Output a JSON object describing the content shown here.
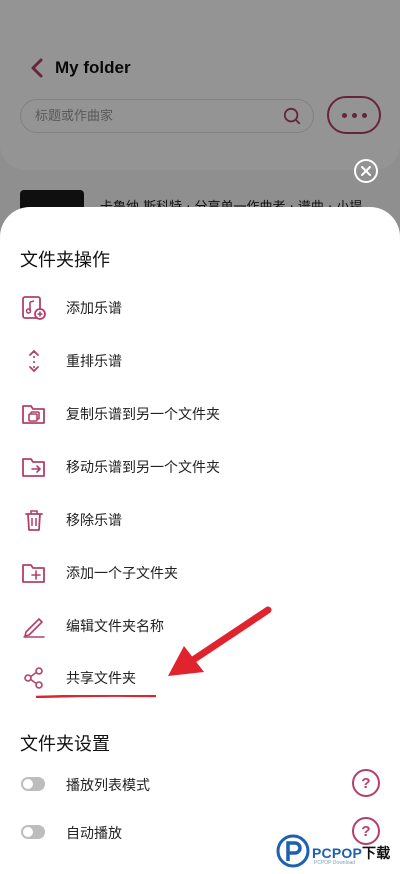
{
  "header": {
    "title": "My folder",
    "search_placeholder": "标题或作曲家",
    "bg_row_text": "卡鲁纳 斯科特  · 分享单一作曲者 · 谱曲 · 小提"
  },
  "sheet": {
    "folder_ops_title": "文件夹操作",
    "items": [
      {
        "label": "添加乐谱",
        "icon": "add-score-icon"
      },
      {
        "label": "重排乐谱",
        "icon": "reorder-icon"
      },
      {
        "label": "复制乐谱到另一个文件夹",
        "icon": "copy-to-folder-icon"
      },
      {
        "label": "移动乐谱到另一个文件夹",
        "icon": "move-to-folder-icon"
      },
      {
        "label": "移除乐谱",
        "icon": "trash-icon"
      },
      {
        "label": "添加一个子文件夹",
        "icon": "add-subfolder-icon"
      },
      {
        "label": "编辑文件夹名称",
        "icon": "pencil-icon"
      },
      {
        "label": "共享文件夹",
        "icon": "share-icon"
      }
    ],
    "folder_settings_title": "文件夹设置",
    "settings": [
      {
        "label": "播放列表模式",
        "enabled": false
      },
      {
        "label": "自动播放",
        "enabled": false
      }
    ],
    "help_glyph": "?"
  },
  "watermark": {
    "brand_blue": "PCPOP",
    "brand_black": "下载",
    "sub": "PCPOP Download"
  },
  "colors": {
    "accent": "#b2406a",
    "annotation_red": "#e0242e"
  }
}
